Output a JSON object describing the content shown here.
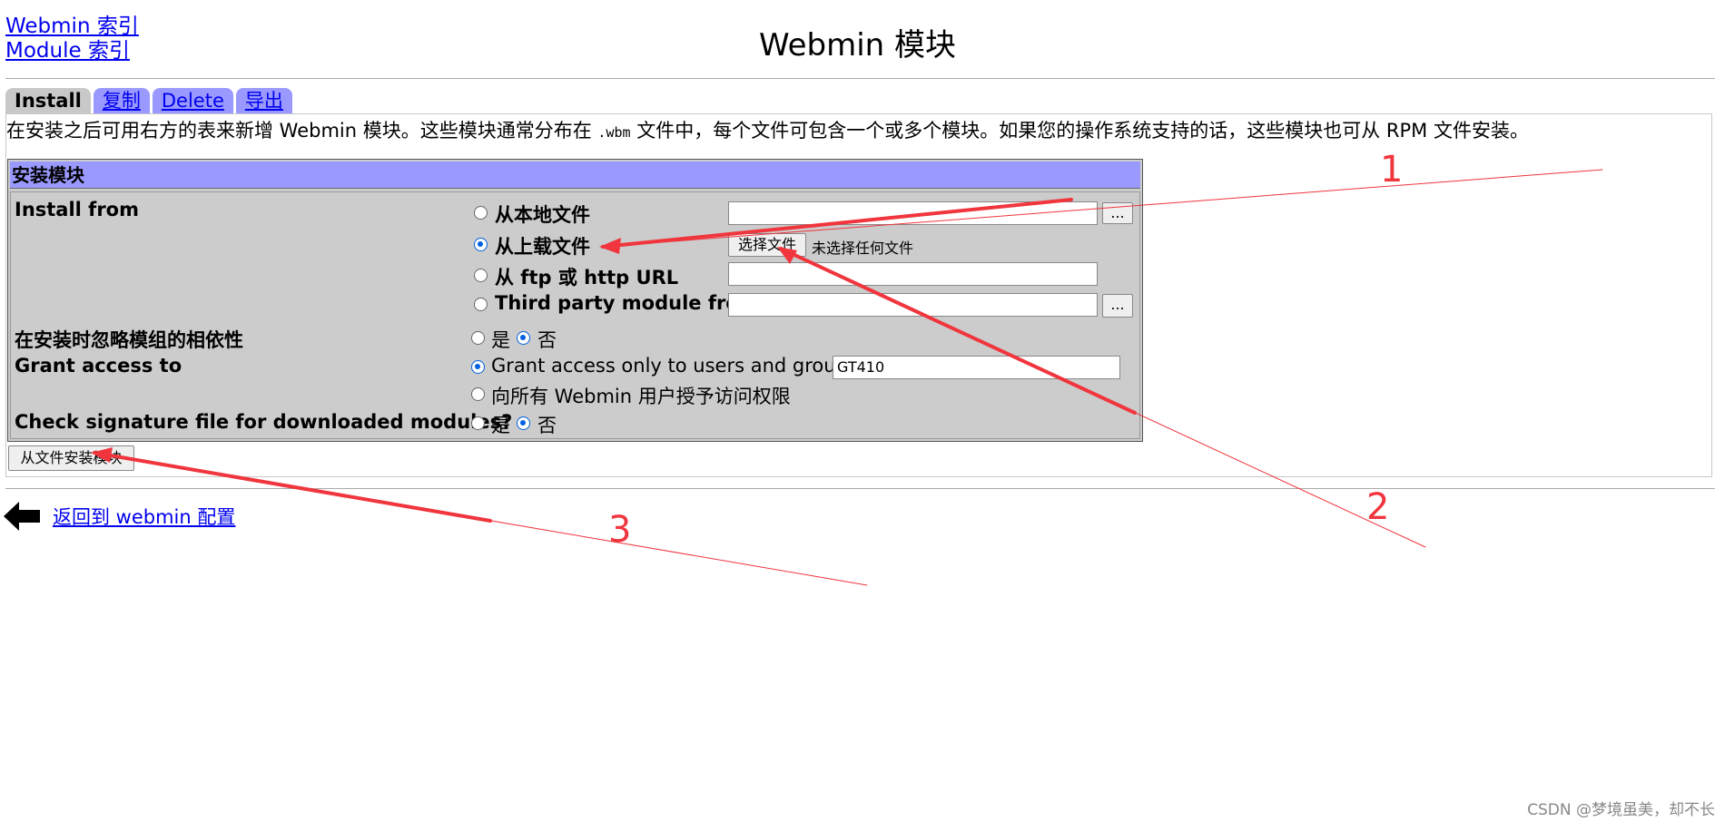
{
  "nav": {
    "webmin_index": "Webmin 索引",
    "module_index": "Module 索引"
  },
  "page": {
    "title": "Webmin 模块"
  },
  "tabs": [
    {
      "label": "Install",
      "active": true
    },
    {
      "label": "复制",
      "active": false
    },
    {
      "label": "Delete",
      "active": false
    },
    {
      "label": "导出",
      "active": false
    }
  ],
  "intro": {
    "before": "在安装之后可用右方的表来新增 Webmin 模块。这些模块通常分布在",
    "ext": ".wbm",
    "after": "文件中，每个文件可包含一个或多个模块。如果您的操作系统支持的话，这些模块也可从 RPM 文件安装。"
  },
  "panel": {
    "header": "安装模块",
    "install_from": {
      "label": "Install from",
      "options": {
        "local": "从本地文件",
        "upload": "从上载文件",
        "url": "从 ftp 或 http URL",
        "third_party": "Third party module from"
      },
      "selected": "upload",
      "browse_label": "...",
      "choose_file_label": "选择文件",
      "no_file_text": "未选择任何文件"
    },
    "ignore_deps": {
      "label": "在安装时忽略模组的相依性",
      "yes": "是",
      "no": "否",
      "selected": "no"
    },
    "grant_access": {
      "label": "Grant access to",
      "only_users": "Grant access only to users and groups",
      "users_value": "GT410",
      "all_users": "向所有 Webmin 用户授予访问权限",
      "selected": "only_users"
    },
    "check_signature": {
      "label": "Check signature file for downloaded modules?",
      "yes": "是",
      "no": "否",
      "selected": "no"
    }
  },
  "submit_label": "从文件安装模块",
  "back_link": "返回到 webmin 配置",
  "annotations": {
    "color": "#f0353d",
    "numbers": [
      "1",
      "2",
      "3"
    ]
  },
  "watermark": "CSDN @梦境虽美，却不长"
}
